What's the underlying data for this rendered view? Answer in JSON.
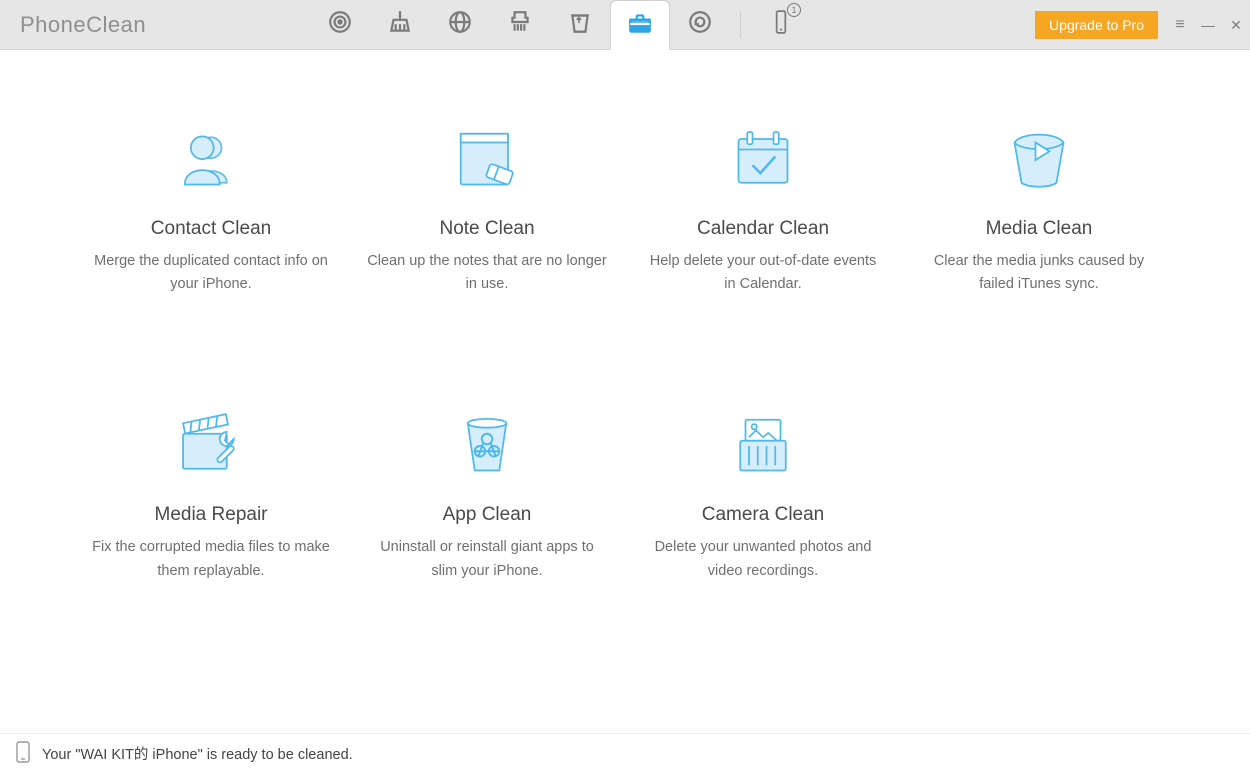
{
  "app_title": "PhoneClean",
  "header": {
    "upgrade_label": "Upgrade to Pro",
    "device_badge": "1"
  },
  "tools": [
    {
      "title": "Contact Clean",
      "desc": "Merge the duplicated contact info on your iPhone."
    },
    {
      "title": "Note Clean",
      "desc": "Clean up the notes that are no longer in use."
    },
    {
      "title": "Calendar Clean",
      "desc": "Help delete your out-of-date events in Calendar."
    },
    {
      "title": "Media Clean",
      "desc": "Clear the media junks caused by failed iTunes sync."
    },
    {
      "title": "Media Repair",
      "desc": "Fix the corrupted media files to make them replayable."
    },
    {
      "title": "App Clean",
      "desc": "Uninstall or reinstall giant apps to slim your iPhone."
    },
    {
      "title": "Camera Clean",
      "desc": "Delete your unwanted photos and video recordings."
    }
  ],
  "status_text": "Your \"WAI KIT的 iPhone\" is ready to be cleaned."
}
